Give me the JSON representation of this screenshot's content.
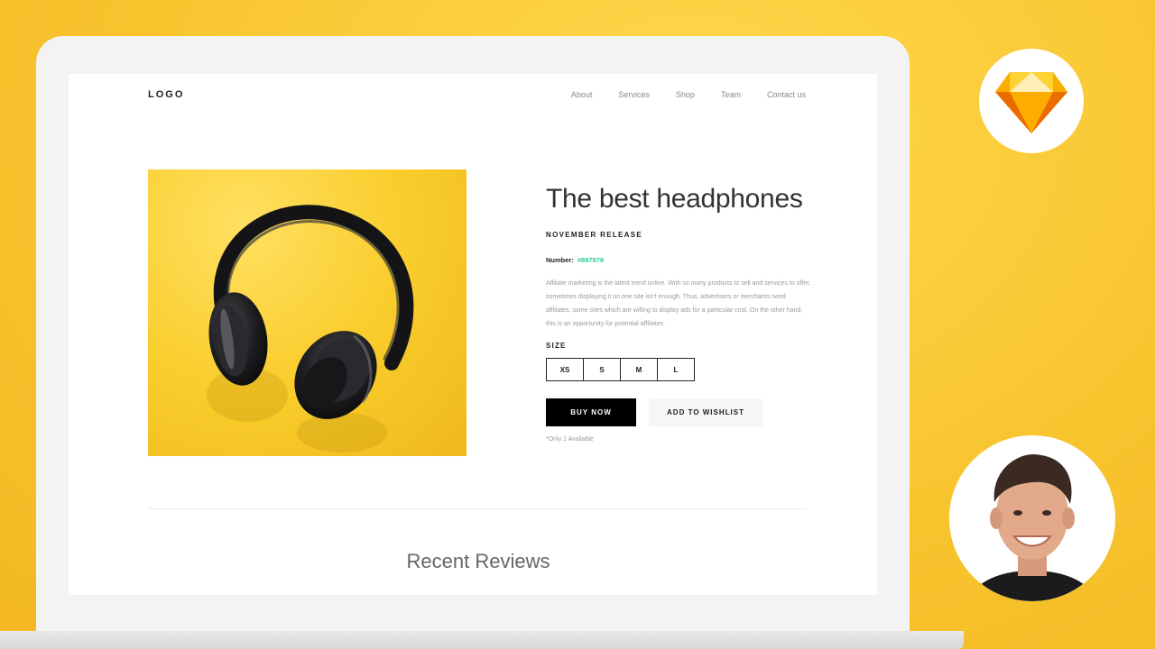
{
  "nav": {
    "logo": "LOGO",
    "links": [
      "About",
      "Services",
      "Shop",
      "Team",
      "Contact us"
    ]
  },
  "product": {
    "title": "The best headphones",
    "release": "NOVEMBER RELEASE",
    "number_label": "Number:",
    "number_value": "#897879",
    "description": "Affiliate marketing is the latest trend online. With so many products to sell and services to offer, sometimes displaying it on one site isn't enough. Thus, advertisers or merchants need affiliates, some sites which are willing to display ads for a particular cost. On the other hand, this is an opportunity for potential affiliates .",
    "size_label": "SIZE",
    "sizes": [
      "XS",
      "S",
      "M",
      "L"
    ],
    "buy_label": "BUY NOW",
    "wishlist_label": "ADD TO WISHLIST",
    "availability": "*Only 1 Available"
  },
  "reviews": {
    "heading": "Recent Reviews"
  },
  "colors": {
    "background": "#f7c42e",
    "accent_green": "#2ccf8e",
    "buy_button": "#000000",
    "sketch_orange": "#f7a21b"
  },
  "icons": {
    "badge": "sketch-logo-icon",
    "image": "headphones-image",
    "avatar": "presenter-avatar"
  }
}
